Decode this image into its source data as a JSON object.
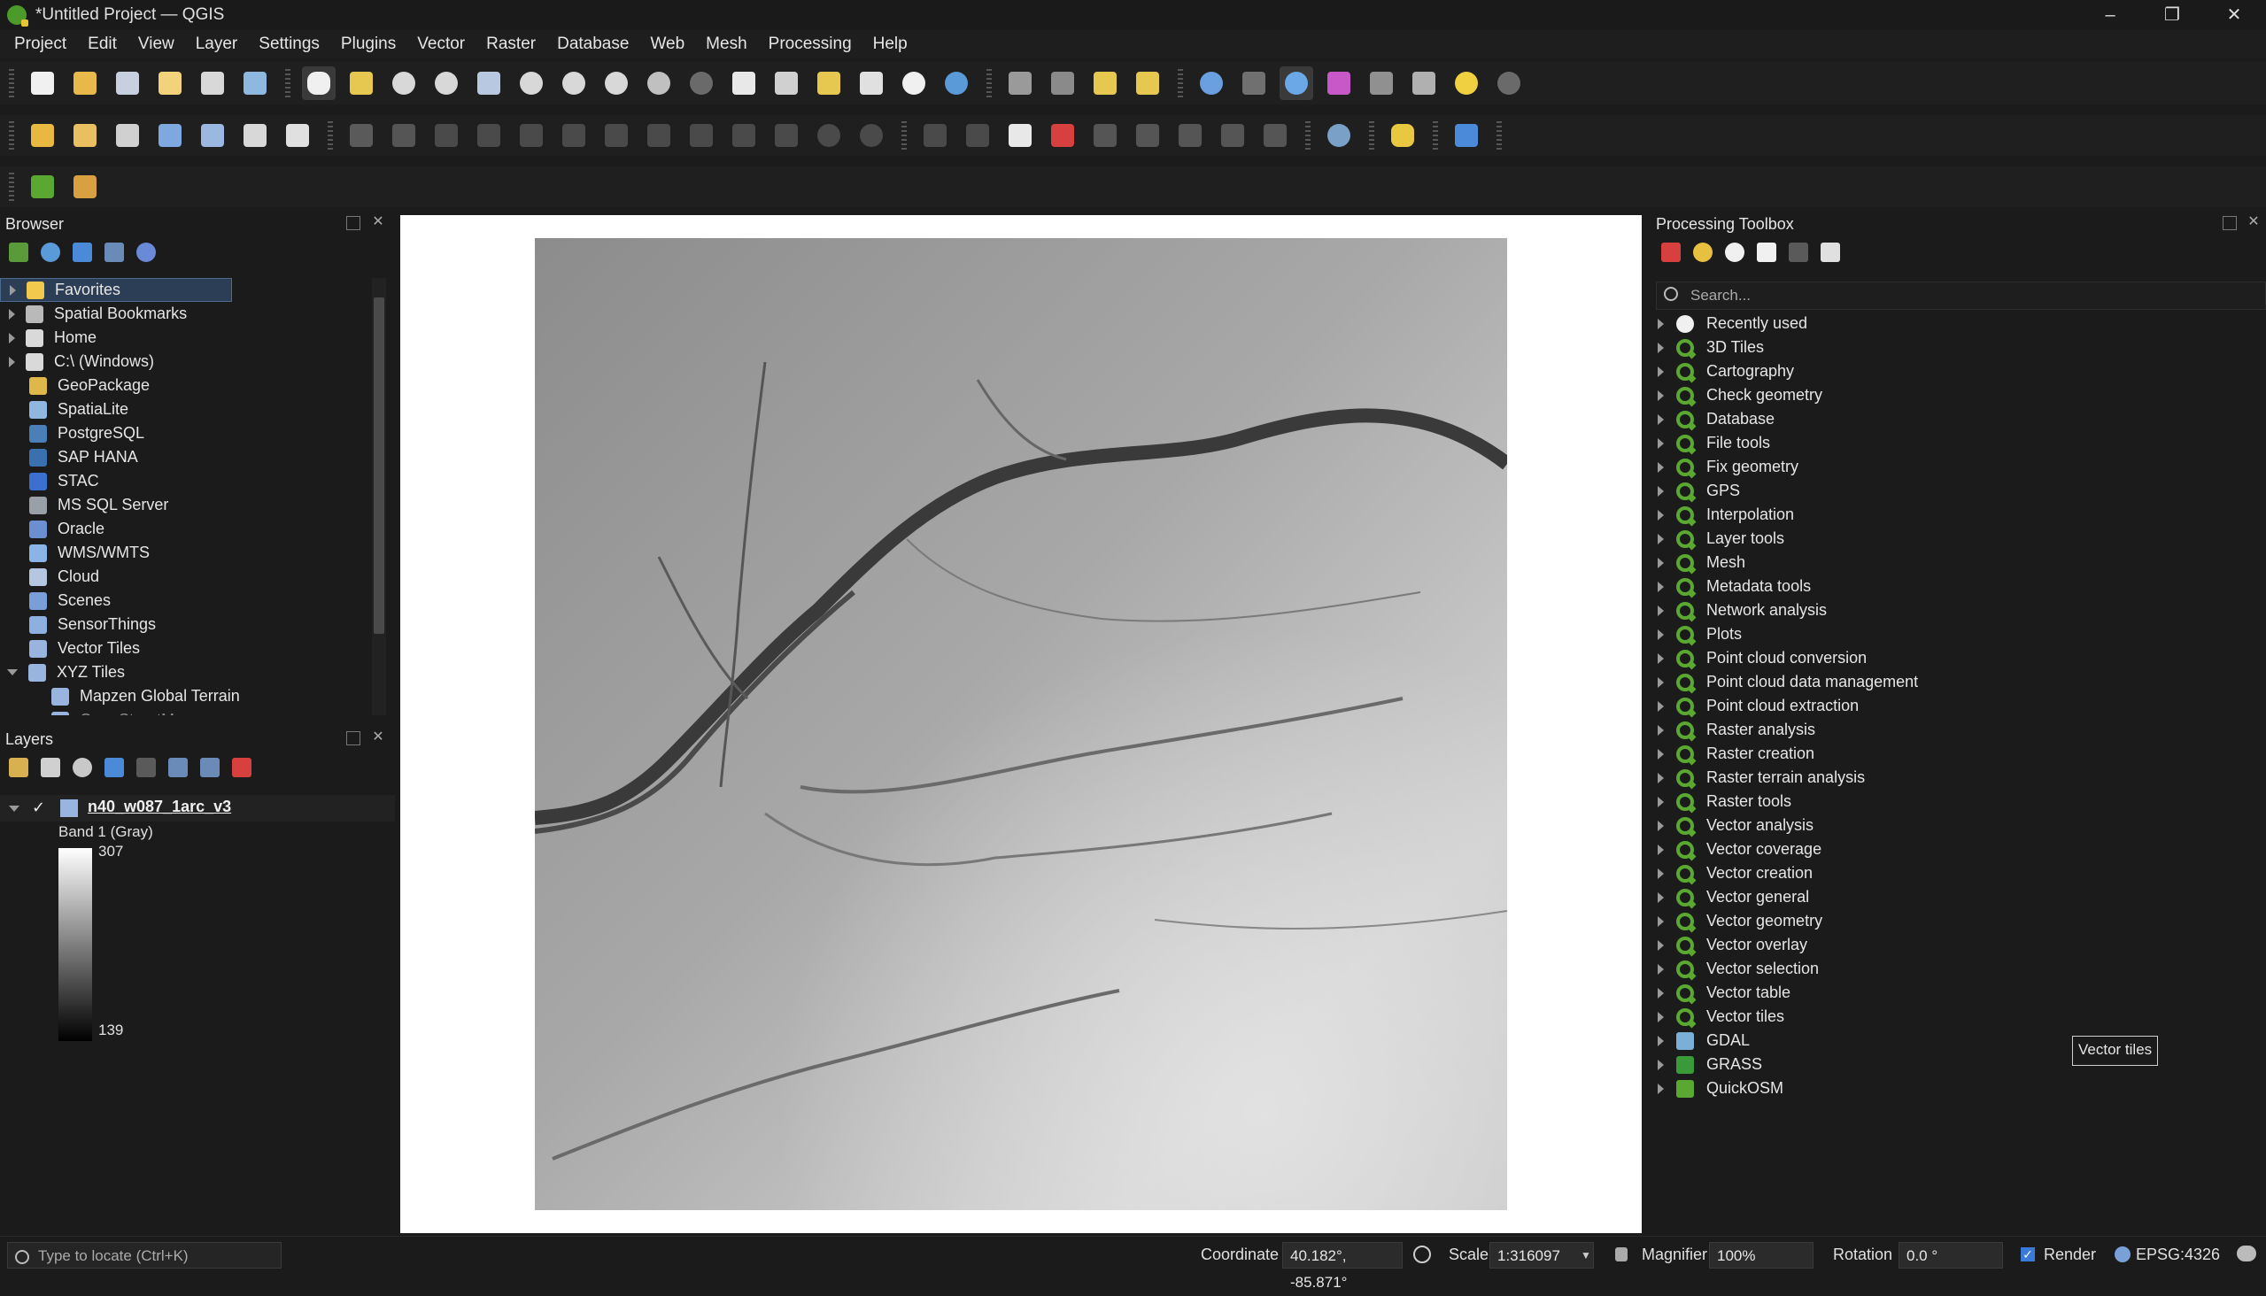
{
  "window": {
    "title": "*Untitled Project — QGIS",
    "controls": [
      "–",
      "❐",
      "✕"
    ]
  },
  "menu": [
    "Project",
    "Edit",
    "View",
    "Layer",
    "Settings",
    "Plugins",
    "Vector",
    "Raster",
    "Database",
    "Web",
    "Mesh",
    "Processing",
    "Help"
  ],
  "browser": {
    "title": "Browser",
    "items": [
      {
        "label": "Favorites",
        "icon": "star-icon",
        "color": "#f2c94c",
        "expand": "right",
        "selected": true
      },
      {
        "label": "Spatial Bookmarks",
        "icon": "bookmark-icon",
        "color": "#b9b9b9",
        "expand": "right"
      },
      {
        "label": "Home",
        "icon": "folder-icon",
        "color": "#d9d9d9",
        "expand": "right"
      },
      {
        "label": "C:\\ (Windows)",
        "icon": "drive-icon",
        "color": "#d9d9d9",
        "expand": "right"
      },
      {
        "label": "GeoPackage",
        "icon": "geopackage-icon",
        "color": "#e0b84a",
        "expand": ""
      },
      {
        "label": "SpatiaLite",
        "icon": "spatialite-icon",
        "color": "#8fb7e0",
        "expand": ""
      },
      {
        "label": "PostgreSQL",
        "icon": "postgresql-icon",
        "color": "#4b7fb8",
        "expand": ""
      },
      {
        "label": "SAP HANA",
        "icon": "sap-hana-icon",
        "color": "#3a6fb0",
        "expand": ""
      },
      {
        "label": "STAC",
        "icon": "stac-icon",
        "color": "#3b6fd0",
        "expand": ""
      },
      {
        "label": "MS SQL Server",
        "icon": "mssql-icon",
        "color": "#9aa0a8",
        "expand": ""
      },
      {
        "label": "Oracle",
        "icon": "oracle-icon",
        "color": "#6b8fd0",
        "expand": ""
      },
      {
        "label": "WMS/WMTS",
        "icon": "globe-icon",
        "color": "#8ab4e8",
        "expand": ""
      },
      {
        "label": "Cloud",
        "icon": "cloud-icon",
        "color": "#b5c7e0",
        "expand": ""
      },
      {
        "label": "Scenes",
        "icon": "scenes-icon",
        "color": "#7a9fd8",
        "expand": ""
      },
      {
        "label": "SensorThings",
        "icon": "sensorthings-icon",
        "color": "#8db0e0",
        "expand": ""
      },
      {
        "label": "Vector Tiles",
        "icon": "grid-icon",
        "color": "#9ab4e0",
        "expand": ""
      },
      {
        "label": "XYZ Tiles",
        "icon": "grid-icon",
        "color": "#9ab4e0",
        "expand": "down"
      },
      {
        "label": "Mapzen Global Terrain",
        "icon": "grid-icon",
        "color": "#9ab4e0",
        "expand": "",
        "indent": true
      },
      {
        "label": "OpenStreetMap",
        "icon": "grid-icon",
        "color": "#9ab4e0",
        "expand": "",
        "indent": true,
        "cut": true
      }
    ]
  },
  "layers": {
    "title": "Layers",
    "layer_name": "n40_w087_1arc_v3",
    "band": "Band 1 (Gray)",
    "max": "307",
    "min": "139"
  },
  "processing": {
    "title": "Processing Toolbox",
    "search_placeholder": "Search...",
    "items": [
      {
        "label": "Recently used",
        "icon": "clock-icon"
      },
      {
        "label": "3D Tiles",
        "icon": "qgis-icon"
      },
      {
        "label": "Cartography",
        "icon": "qgis-icon"
      },
      {
        "label": "Check geometry",
        "icon": "qgis-icon"
      },
      {
        "label": "Database",
        "icon": "qgis-icon"
      },
      {
        "label": "File tools",
        "icon": "qgis-icon"
      },
      {
        "label": "Fix geometry",
        "icon": "qgis-icon"
      },
      {
        "label": "GPS",
        "icon": "qgis-icon"
      },
      {
        "label": "Interpolation",
        "icon": "qgis-icon"
      },
      {
        "label": "Layer tools",
        "icon": "qgis-icon"
      },
      {
        "label": "Mesh",
        "icon": "qgis-icon"
      },
      {
        "label": "Metadata tools",
        "icon": "qgis-icon"
      },
      {
        "label": "Network analysis",
        "icon": "qgis-icon"
      },
      {
        "label": "Plots",
        "icon": "qgis-icon"
      },
      {
        "label": "Point cloud conversion",
        "icon": "qgis-icon"
      },
      {
        "label": "Point cloud data management",
        "icon": "qgis-icon"
      },
      {
        "label": "Point cloud extraction",
        "icon": "qgis-icon"
      },
      {
        "label": "Raster analysis",
        "icon": "qgis-icon"
      },
      {
        "label": "Raster creation",
        "icon": "qgis-icon"
      },
      {
        "label": "Raster terrain analysis",
        "icon": "qgis-icon"
      },
      {
        "label": "Raster tools",
        "icon": "qgis-icon"
      },
      {
        "label": "Vector analysis",
        "icon": "qgis-icon"
      },
      {
        "label": "Vector coverage",
        "icon": "qgis-icon"
      },
      {
        "label": "Vector creation",
        "icon": "qgis-icon"
      },
      {
        "label": "Vector general",
        "icon": "qgis-icon"
      },
      {
        "label": "Vector geometry",
        "icon": "qgis-icon"
      },
      {
        "label": "Vector overlay",
        "icon": "qgis-icon"
      },
      {
        "label": "Vector selection",
        "icon": "qgis-icon"
      },
      {
        "label": "Vector table",
        "icon": "qgis-icon"
      },
      {
        "label": "Vector tiles",
        "icon": "qgis-icon"
      },
      {
        "label": "GDAL",
        "icon": "gdal-icon"
      },
      {
        "label": "GRASS",
        "icon": "grass-icon"
      },
      {
        "label": "QuickOSM",
        "icon": "quickosm-icon"
      }
    ],
    "tooltip": "Vector tiles"
  },
  "status": {
    "locate_placeholder": "Type to locate (Ctrl+K)",
    "coordinate_label": "Coordinate",
    "coordinate": "40.182°, -85.871°",
    "scale_label": "Scale",
    "scale": "1:316097",
    "magnifier_label": "Magnifier",
    "magnifier": "100%",
    "rotation_label": "Rotation",
    "rotation": "0.0 °",
    "render_label": "Render",
    "crs": "EPSG:4326"
  }
}
